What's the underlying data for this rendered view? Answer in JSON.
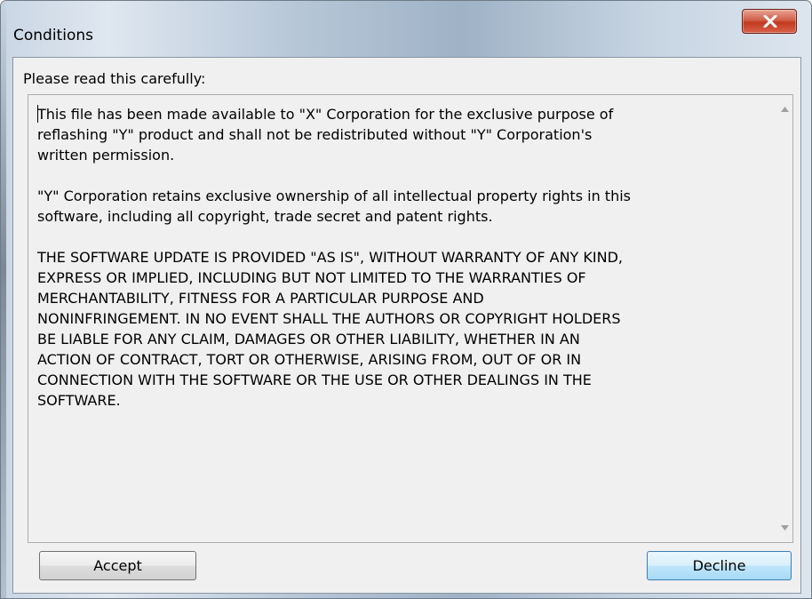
{
  "window": {
    "title": "Conditions"
  },
  "dialog": {
    "prompt": "Please read this carefully:",
    "license_text": "This file has been made available to \"X\" Corporation for the exclusive purpose of\nreflashing \"Y\" product and shall not be redistributed without \"Y\" Corporation's\nwritten permission.\n\n\"Y\" Corporation retains exclusive ownership of all intellectual property rights in this\nsoftware, including all copyright, trade secret and patent rights.\n\nTHE SOFTWARE UPDATE IS PROVIDED \"AS IS\", WITHOUT WARRANTY OF ANY KIND,\nEXPRESS OR IMPLIED, INCLUDING BUT NOT LIMITED TO THE WARRANTIES OF\nMERCHANTABILITY, FITNESS FOR A PARTICULAR PURPOSE AND\nNONINFRINGEMENT. IN NO EVENT SHALL THE AUTHORS OR COPYRIGHT HOLDERS\nBE LIABLE FOR ANY CLAIM, DAMAGES OR OTHER LIABILITY, WHETHER IN AN\nACTION OF CONTRACT, TORT OR OTHERWISE, ARISING FROM, OUT OF OR IN\nCONNECTION WITH THE SOFTWARE OR THE USE OR OTHER DEALINGS IN THE\nSOFTWARE."
  },
  "buttons": {
    "accept_label": "Accept",
    "decline_label": "Decline"
  },
  "icons": {
    "close": "close-icon",
    "scroll_up": "chevron-up-icon",
    "scroll_down": "chevron-down-icon"
  },
  "colors": {
    "close_button": "#c23a1f",
    "focused_button_border": "#3c7fb1",
    "dialog_background": "#f0f0f0"
  }
}
